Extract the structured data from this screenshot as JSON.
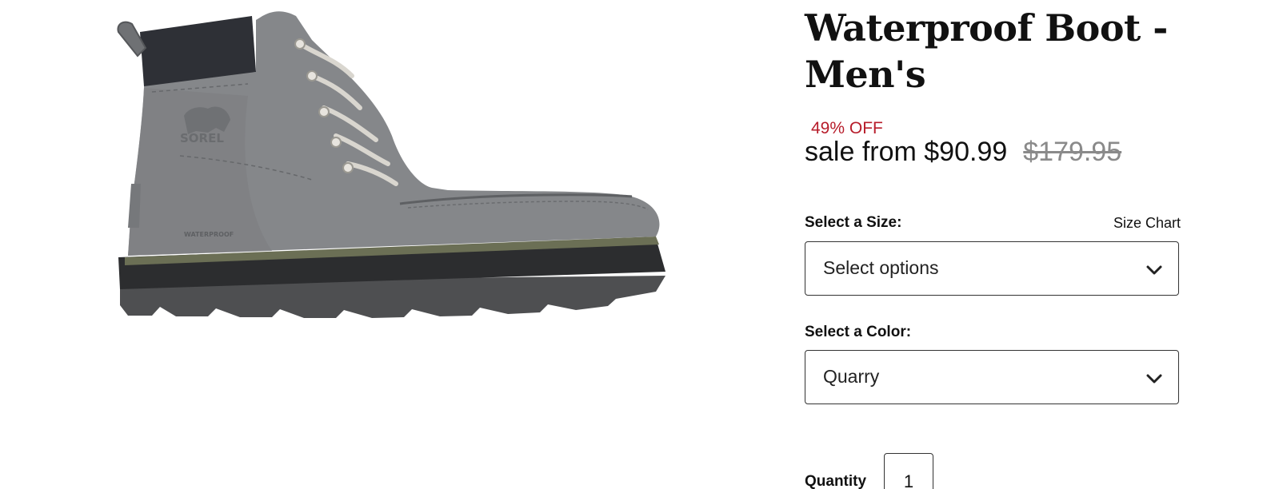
{
  "product": {
    "title": "Waterproof Boot - Men's",
    "image_alt": "Grey leather lace-up waterproof boot",
    "image_brand_mark": "SOREL",
    "image_side_mark": "WATERPROOF"
  },
  "pricing": {
    "discount": "49% OFF",
    "sale_label": "sale from $90.99",
    "original_price": "$179.95",
    "discount_color": "#b71c2a"
  },
  "size": {
    "label": "Select a Size:",
    "chart_link": "Size Chart",
    "value": "Select options",
    "icon": "chevron-down-icon"
  },
  "color": {
    "label": "Select a Color:",
    "value": "Quarry",
    "icon": "chevron-down-icon"
  },
  "quantity": {
    "label": "Quantity",
    "value": "1"
  }
}
